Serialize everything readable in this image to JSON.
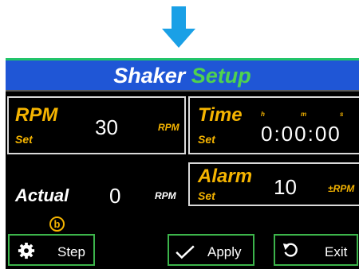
{
  "header": {
    "title_part1": "Shaker",
    "title_part2": "Setup"
  },
  "rpm_panel": {
    "label": "RPM",
    "sub": "Set",
    "value": "30",
    "unit": "RPM"
  },
  "time_panel": {
    "label": "Time",
    "sub": "Set",
    "value": "0:00:00",
    "h": "h",
    "m": "m",
    "s": "s"
  },
  "actual": {
    "label": "Actual",
    "value": "0",
    "unit": "RPM"
  },
  "alarm_panel": {
    "label": "Alarm",
    "sub": "Set",
    "value": "10",
    "unit": "±RPM"
  },
  "badge": "b",
  "buttons": {
    "step": "Step",
    "apply": "Apply",
    "exit": "Exit"
  },
  "colors": {
    "accent": "#f5b400",
    "title_bg": "#1f56d6",
    "title_green": "#4fd24f",
    "button_border": "#3cb44b",
    "arrow": "#1aa0e6"
  }
}
